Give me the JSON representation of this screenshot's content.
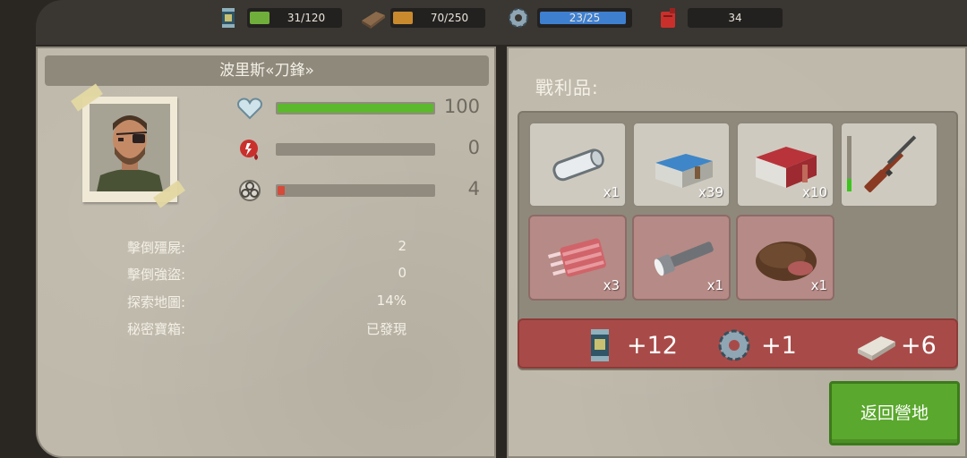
{
  "topbar": {
    "resources": [
      {
        "icon": "can-icon",
        "value": "31/120",
        "color": "#6fae3a",
        "fill": 0.26
      },
      {
        "icon": "wood-plank-icon",
        "value": "70/250",
        "color": "#c98a2e",
        "fill": 0.28
      },
      {
        "icon": "gear-icon",
        "value": "23/25",
        "color": "#3e7fd0",
        "fill": 0.92
      },
      {
        "icon": "fuel-can-icon",
        "value": "34",
        "color": "#c9302c",
        "fill": 0
      }
    ]
  },
  "character": {
    "name": "波里斯«刀鋒»",
    "stats": [
      {
        "icon": "heart-icon",
        "value": "100",
        "fill": 1.0,
        "color": "#5cb82c"
      },
      {
        "icon": "bleeding-icon",
        "value": "0",
        "fill": 0,
        "color": "#c9302c"
      },
      {
        "icon": "biohazard-icon",
        "value": "4",
        "fill": 0.04,
        "color": "#d64a3a"
      }
    ],
    "records": [
      {
        "label": "擊倒殭屍:",
        "value": "2"
      },
      {
        "label": "擊倒強盜:",
        "value": "0"
      },
      {
        "label": "探索地圖:",
        "value": "14%"
      },
      {
        "label": "秘密寶箱:",
        "value": "已發現"
      }
    ]
  },
  "loot": {
    "title": "戰利品:",
    "items": [
      {
        "name": "bandage-roll-icon",
        "qty": "x1",
        "red": false
      },
      {
        "name": "blue-ammo-box-icon",
        "qty": "x39",
        "red": false
      },
      {
        "name": "red-ammo-box-icon",
        "qty": "x10",
        "red": false
      },
      {
        "name": "hunting-rifle-icon",
        "qty": "",
        "red": false
      },
      {
        "name": "raw-meat-icon",
        "qty": "x3",
        "red": true
      },
      {
        "name": "flashlight-icon",
        "qty": "x1",
        "red": true
      },
      {
        "name": "roast-meat-icon",
        "qty": "x1",
        "red": true
      }
    ],
    "rewards": [
      {
        "icon": "can-icon",
        "text": "+12"
      },
      {
        "icon": "gear-icon",
        "text": "+1"
      },
      {
        "icon": "wood-plank-icon",
        "text": "+6"
      }
    ],
    "return_button": "返回營地"
  }
}
